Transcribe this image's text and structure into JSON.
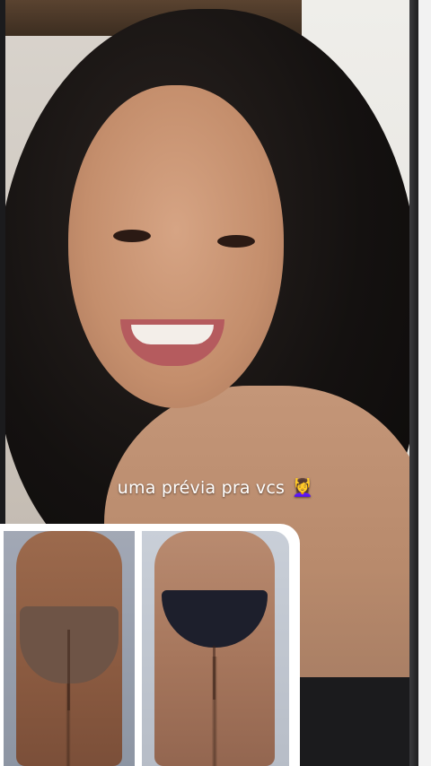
{
  "story": {
    "caption_text": "uma prévia pra vcs",
    "caption_emoji": "💆‍♀️"
  },
  "colors": {
    "background": "#1b1b1d",
    "caption_text": "#ffffff",
    "card_background": "#ffffff"
  },
  "images": {
    "main": "selfie-photo",
    "before": "before-photo",
    "after": "after-photo"
  }
}
